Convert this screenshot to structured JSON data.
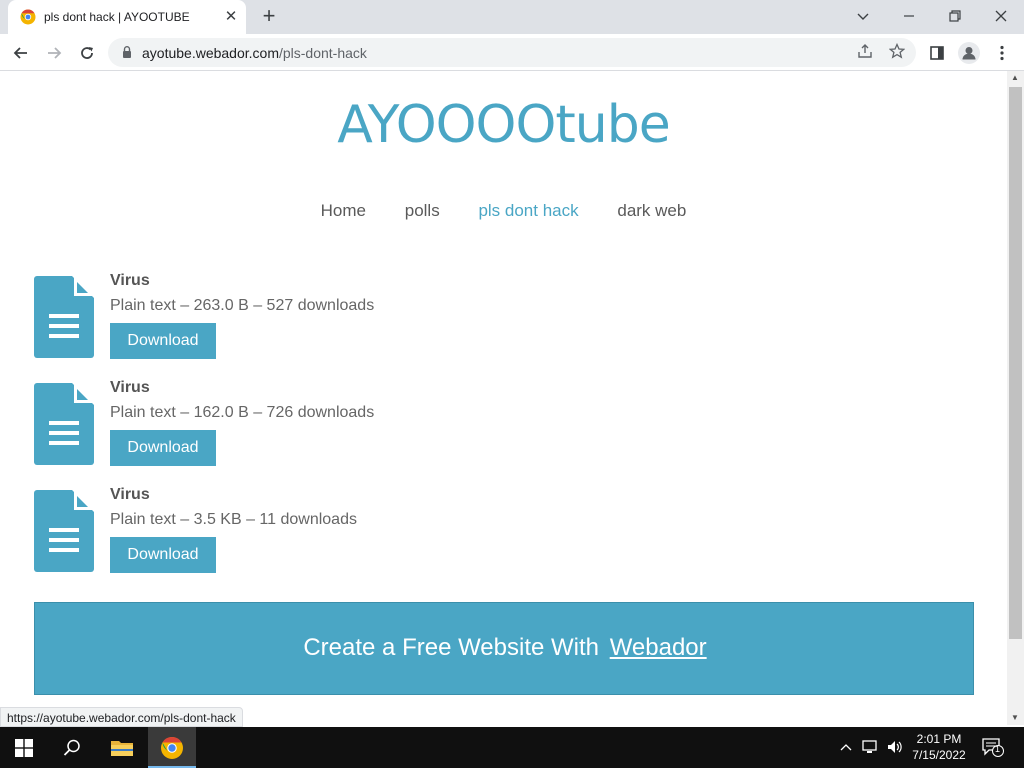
{
  "browser": {
    "tab_title": "pls dont hack | AYOOTUBE",
    "tab_close": "✕",
    "new_tab": "+",
    "url_domain": "ayotube.webador.com",
    "url_path": "/pls-dont-hack",
    "status_url": "https://ayotube.webador.com/pls-dont-hack"
  },
  "site": {
    "title": "AYOOOOtube",
    "nav": [
      {
        "label": "Home",
        "active": false
      },
      {
        "label": "polls",
        "active": false
      },
      {
        "label": "pls dont hack",
        "active": true
      },
      {
        "label": "dark web",
        "active": false
      }
    ],
    "files": [
      {
        "name": "Virus",
        "meta": "Plain text – 263.0 B – 527 downloads",
        "button": "Download"
      },
      {
        "name": "Virus",
        "meta": "Plain text – 162.0 B – 726 downloads",
        "button": "Download"
      },
      {
        "name": "Virus",
        "meta": "Plain text – 3.5 KB – 11 downloads",
        "button": "Download"
      }
    ],
    "banner_text": "Create a Free Website With",
    "banner_brand": "Webador"
  },
  "taskbar": {
    "time": "2:01 PM",
    "date": "7/15/2022",
    "notification_count": "1"
  },
  "colors": {
    "accent": "#4aa6c5"
  }
}
